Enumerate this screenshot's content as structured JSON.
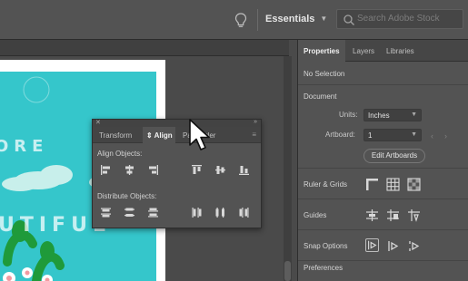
{
  "topbar": {
    "workspace_label": "Essentials",
    "search_placeholder": "Search Adobe Stock",
    "lightbulb_icon": "lightbulb-icon",
    "search_icon": "search-icon"
  },
  "artwork": {
    "word_1": "ORE",
    "word_2": "UTIFUL",
    "background_color": "#35c6cb"
  },
  "align_panel": {
    "tabs": [
      {
        "label": "Transform"
      },
      {
        "label": "Align",
        "prefix": "⇕",
        "active": true
      },
      {
        "label": "Pathfinder"
      }
    ],
    "align_objects_label": "Align Objects:",
    "distribute_objects_label": "Distribute Objects:",
    "align_icons": [
      "horizontal-align-left-icon",
      "horizontal-align-center-icon",
      "horizontal-align-right-icon",
      "vertical-align-top-icon",
      "vertical-align-center-icon",
      "vertical-align-bottom-icon"
    ],
    "distribute_icons": [
      "vertical-distribute-top-icon",
      "vertical-distribute-center-icon",
      "vertical-distribute-bottom-icon",
      "horizontal-distribute-left-icon",
      "horizontal-distribute-center-icon",
      "horizontal-distribute-right-icon"
    ]
  },
  "properties": {
    "tabs": {
      "properties": "Properties",
      "layers": "Layers",
      "libraries": "Libraries"
    },
    "selection": "No Selection",
    "document_label": "Document",
    "units_label": "Units:",
    "units_value": "Inches",
    "artboard_label": "Artboard:",
    "artboard_value": "1",
    "edit_artboards": "Edit Artboards",
    "ruler_grids_label": "Ruler & Grids",
    "guides_label": "Guides",
    "snap_options_label": "Snap Options",
    "preferences_label": "Preferences"
  },
  "colors": {
    "panel_bg": "#535353",
    "topbar_bg": "#535353",
    "artwork_teal": "#35c6cb",
    "icon_gray": "#d8d8d8"
  }
}
